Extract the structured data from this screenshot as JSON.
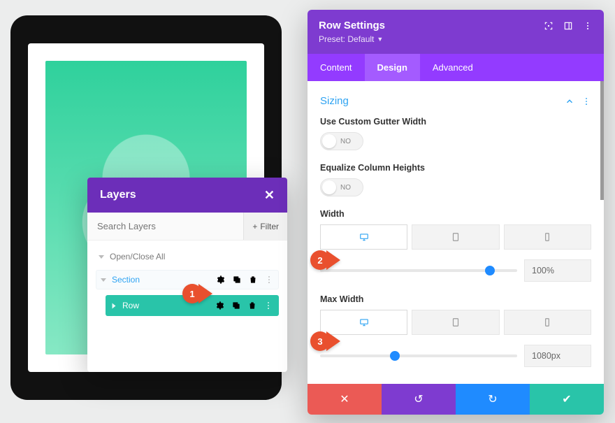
{
  "layers": {
    "title": "Layers",
    "search_placeholder": "Search Layers",
    "filter_label": "Filter",
    "open_close": "Open/Close All",
    "section_label": "Section",
    "row_label": "Row"
  },
  "panel": {
    "title": "Row Settings",
    "preset": "Preset: Default",
    "tabs": {
      "content": "Content",
      "design": "Design",
      "advanced": "Advanced"
    },
    "section": "Sizing",
    "gutter_label": "Use Custom Gutter Width",
    "gutter_value": "NO",
    "equalize_label": "Equalize Column Heights",
    "equalize_value": "NO",
    "width_label": "Width",
    "width_value": "100%",
    "maxwidth_label": "Max Width",
    "maxwidth_value": "1080px"
  },
  "markers": {
    "m1": "1",
    "m2": "2",
    "m3": "3"
  }
}
